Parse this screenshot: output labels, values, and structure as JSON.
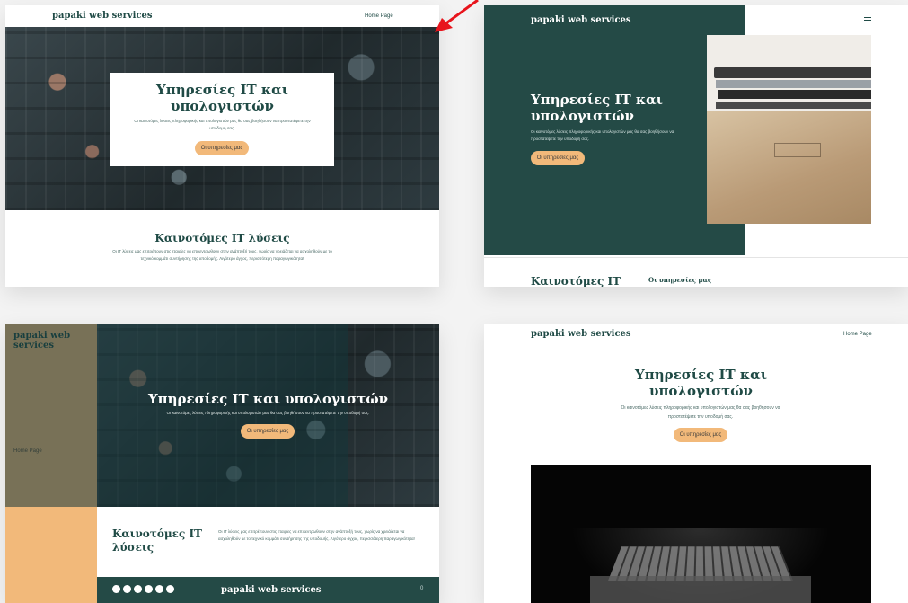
{
  "brand_name": "papaki web services",
  "nav_link": "Home Page",
  "hero": {
    "title_line1": "Υπηρεσίες IT και",
    "title_line2": "υπολογιστών",
    "title_full": "Υπηρεσίες IT και υπολογιστών",
    "subtitle_a": "Οι καινοτόμες λύσεις πληροφορικής και υπολογιστών μας θα σας βοηθήσουν να προστατέψετε την",
    "subtitle_b": "υποδομή σας.",
    "subtitle_full": "Οι καινοτόμες λύσεις πληροφορικής και υπολογιστών μας θα σας βοηθήσουν να προστατέψετε την υποδομή σας.",
    "button": "Οι υπηρεσίες μας"
  },
  "section": {
    "title": "Καινοτόμες IT λύσεις",
    "title_short": "Καινοτόμες IT",
    "title_word2": "λύσεις",
    "text_a": "Οι IT λύσεις μας επιτρέπουν στις εταιρίες να επικεντρωθούν στην ανάπτυξή τους, χωρίς να χρειάζεται να ασχοληθούν με το",
    "text_b": "τεχνικό κομμάτι συντήρησης της υποδομής. Λιγότερο άγχος, περισσότερη παραγωγικότητα!",
    "text_full": "Οι IT λύσεις μας επιτρέπουν στις εταιρίες να επικεντρωθούν στην ανάπτυξή τους, χωρίς να χρειάζεται να ασχοληθούν με το τεχνικό κομμάτι συντήρησης της υποδομής. Λιγότερο άγχος, περισσότερη παραγωγικότητα!"
  },
  "menu_icon": "hamburger-icon",
  "footer_counter": "0",
  "social_icons": [
    "twitter-icon",
    "facebook-icon",
    "instagram-icon",
    "pinterest-icon",
    "youtube-icon",
    "x-icon"
  ],
  "colors": {
    "accent": "#f2b97a",
    "dark_teal": "#1f4a45",
    "arrow": "#e8141c"
  }
}
